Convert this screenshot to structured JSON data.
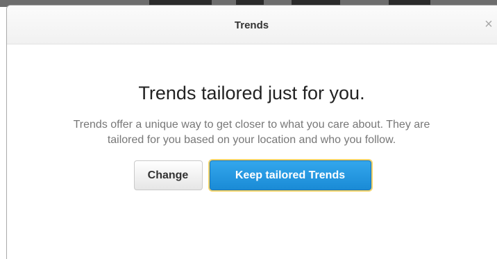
{
  "modal": {
    "title": "Trends",
    "close_label": "×"
  },
  "content": {
    "heading": "Trends tailored just for you.",
    "description": "Trends offer a unique way to get closer to what you care about. They are tailored for you based on your location and who you follow."
  },
  "buttons": {
    "change_label": "Change",
    "keep_label": "Keep tailored Trends"
  },
  "colors": {
    "primary_button": "#1a8bd6",
    "focus_ring": "#f4d56b",
    "heading_text": "#222222",
    "body_text": "#777777"
  }
}
